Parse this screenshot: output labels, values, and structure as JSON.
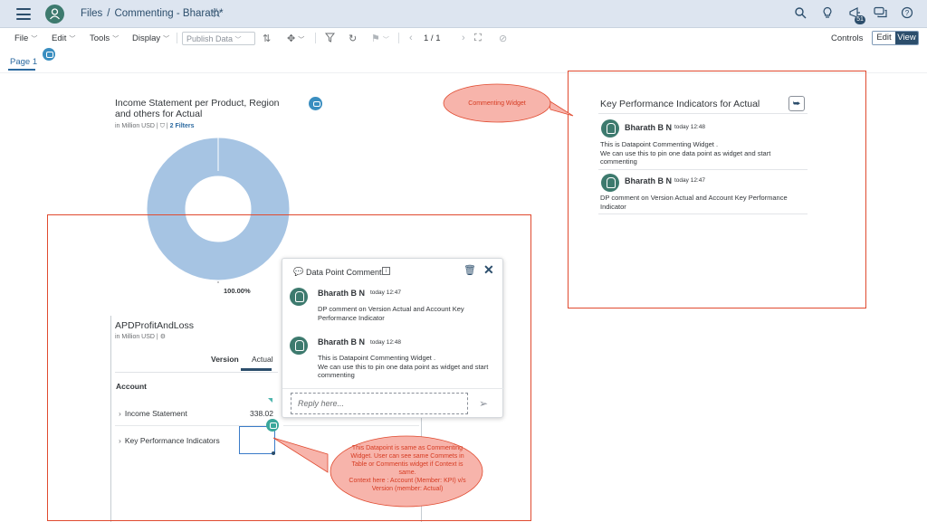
{
  "shell": {
    "breadcrumb_root": "Files",
    "breadcrumb_sep": "/",
    "title": "Commenting - Bharath*",
    "notification_count": "51"
  },
  "toolbar": {
    "file": "File",
    "edit": "Edit",
    "tools": "Tools",
    "display": "Display",
    "publish_data": "Publish Data",
    "page_indicator": "1 / 1",
    "controls": "Controls",
    "mode_edit": "Edit",
    "mode_view": "View"
  },
  "page_tab": "Page 1",
  "chart": {
    "title": "Income Statement per Product, Region and others for Actual",
    "unit": "in Million USD",
    "filters": "2 Filters",
    "chart_data": {
      "type": "pie",
      "categories": [
        "Actual"
      ],
      "values": [
        100
      ],
      "data_label": "100.00%",
      "color": "#a6c4e3"
    }
  },
  "table": {
    "title": "APDProfitAndLoss",
    "unit": "in Million USD",
    "header_version": "Version",
    "header_actual": "Actual",
    "account": "Account",
    "rows": [
      {
        "label": "Income Statement",
        "value": "338.02"
      },
      {
        "label": "Key Performance Indicators",
        "value": ""
      }
    ]
  },
  "popover": {
    "title": "Data Point Comment",
    "comments": [
      {
        "author": "Bharath B N",
        "time": "today 12:47",
        "text": "DP comment on Version Actual and Account Key Performance Indicator"
      },
      {
        "author": "Bharath B N",
        "time": "today 12:48",
        "text": "This is Datapoint Commenting Widget .\nWe can use this to pin one data point as widget and  start commenting"
      }
    ],
    "reply_placeholder": "Reply here..."
  },
  "kpi_widget": {
    "title": "Key Performance Indicators for Actual",
    "comments": [
      {
        "author": "Bharath B N",
        "time": "today 12:48",
        "text": "This is Datapoint Commenting Widget .\n We can use this to pin one data point as widget and  start commenting"
      },
      {
        "author": "Bharath B N",
        "time": "today 12:47",
        "text": "DP comment on Version Actual and Account Key Performance Indicator"
      }
    ]
  },
  "annotations": {
    "commenting_widget": "Commenting Widget",
    "datapoint_note": "This Datapoint is same as Commenting Widget. User can see same Commets in Table or Commentis widget if Context is same.\nContext here :  Account (Member: KPI) v/s Version (member: Actual)"
  },
  "colors": {
    "shell_bg": "#dde5f0",
    "accent": "#2c4e6c",
    "annotation_red": "#e04a2f",
    "avatar": "#3d7a6e",
    "donut": "#a6c4e3"
  }
}
